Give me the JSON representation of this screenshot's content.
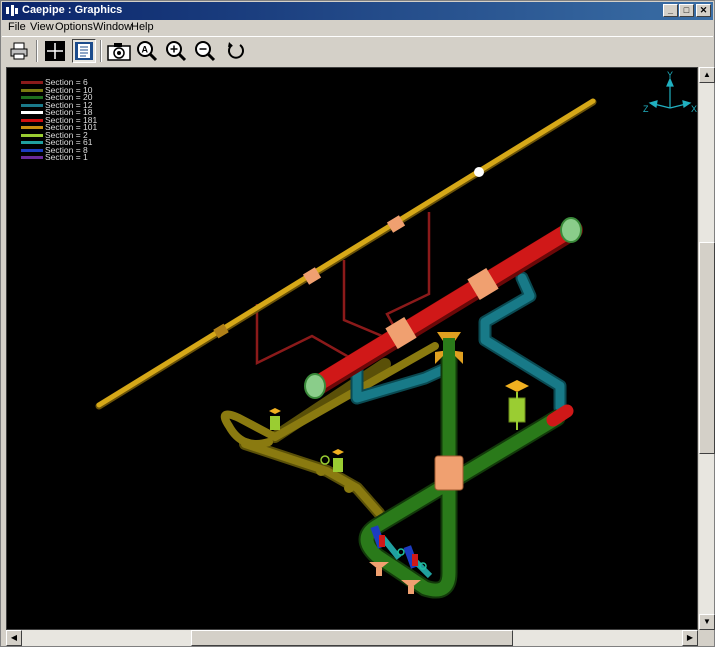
{
  "window": {
    "title": "Caepipe : Graphics",
    "controls": {
      "minimize": "_",
      "maximize": "□",
      "close": "✕"
    }
  },
  "menu": [
    {
      "label": "File"
    },
    {
      "label": "View"
    },
    {
      "label": "Options"
    },
    {
      "label": "Window"
    },
    {
      "label": "Help"
    }
  ],
  "toolbar": {
    "tools": [
      {
        "name": "print",
        "icon": "printer-icon"
      },
      {
        "name": "crosshair",
        "icon": "crosshair-icon"
      },
      {
        "name": "notes",
        "icon": "document-icon",
        "pressed": true
      },
      {
        "name": "snapshot",
        "icon": "camera-icon"
      },
      {
        "name": "zoom-window",
        "icon": "zoom-a-icon"
      },
      {
        "name": "zoom-in",
        "icon": "zoom-in-icon"
      },
      {
        "name": "zoom-out",
        "icon": "zoom-out-icon"
      },
      {
        "name": "rotate",
        "icon": "rotate-icon"
      }
    ]
  },
  "legend": [
    {
      "label": "Section = 6",
      "color": "#8b1a1a"
    },
    {
      "label": "Section = 10",
      "color": "#7a7a10"
    },
    {
      "label": "Section = 20",
      "color": "#1e6e1e"
    },
    {
      "label": "Section = 12",
      "color": "#1a7a8a"
    },
    {
      "label": "Section = 18",
      "color": "#ffffff"
    },
    {
      "label": "Section = 181",
      "color": "#d01010"
    },
    {
      "label": "Section = 101",
      "color": "#c89010"
    },
    {
      "label": "Section = 2",
      "color": "#9acd32"
    },
    {
      "label": "Section = 61",
      "color": "#20a0a0"
    },
    {
      "label": "Section = 8",
      "color": "#1c3cc0"
    },
    {
      "label": "Section = 1",
      "color": "#6a2a9a"
    }
  ],
  "triad": {
    "x": "X",
    "y": "Y",
    "z": "Z",
    "color": "#20b0c0"
  },
  "colors": {
    "yellow_pipe": "#c8a010",
    "red_pipe": "#d01818",
    "green_pipe": "#2a7a1a",
    "teal_pipe": "#187a88",
    "olive_pipe": "#8a7a10",
    "darkred_line": "#8b1a1a",
    "salmon_support": "#f0a070"
  }
}
